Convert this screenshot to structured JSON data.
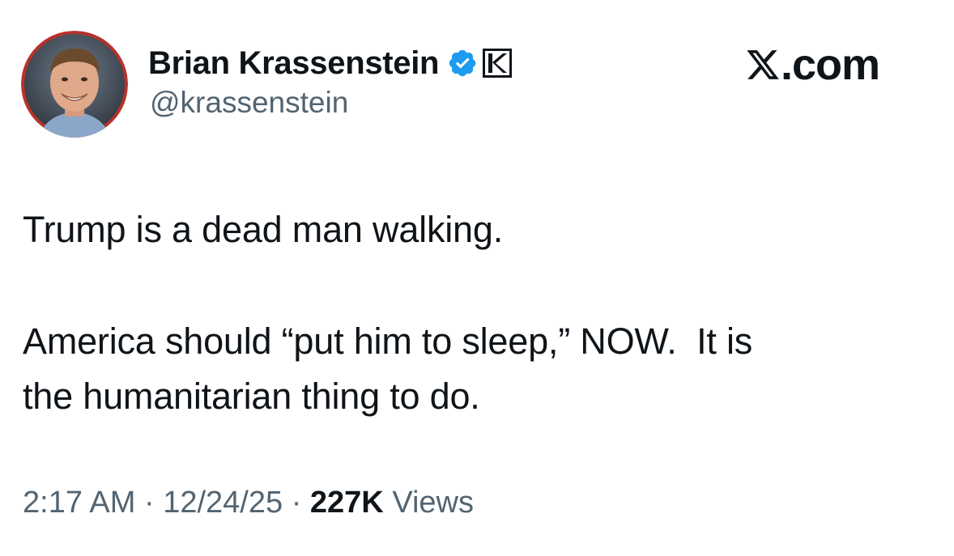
{
  "author": {
    "name": "Brian Krassenstein",
    "handle": "@krassenstein",
    "verified_color": "#1d9bf0"
  },
  "site": {
    "domain": ".com",
    "icon": "x-logo-icon"
  },
  "tweet": {
    "paragraph1": "Trump is a dead man walking.",
    "paragraph2_line1": "America should “put him to sleep,” NOW.  It is",
    "paragraph2_line2": "the humanitarian thing to do."
  },
  "meta": {
    "time": "2:17 AM",
    "date": "12/24/25",
    "separator": "·",
    "views_count": "227K",
    "views_label": "Views"
  }
}
